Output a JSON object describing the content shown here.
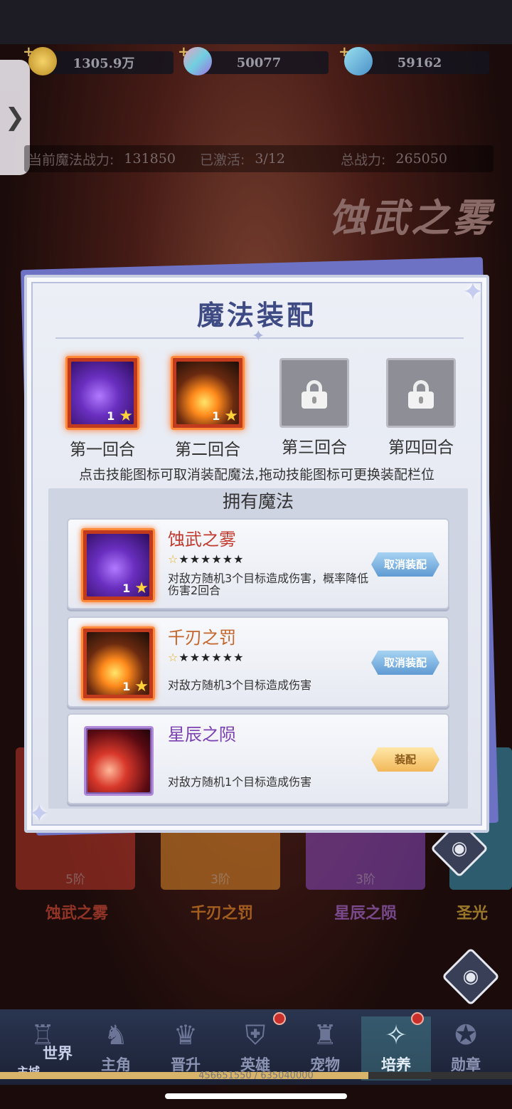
{
  "resources": [
    {
      "value": "1305.9万",
      "icon": "gold-coin-icon",
      "color": "#e0b445"
    },
    {
      "value": "50077",
      "icon": "gem-icon",
      "color": "#7ad0d8"
    },
    {
      "value": "59162",
      "icon": "crystal-icon",
      "color": "#8ac8e8"
    }
  ],
  "power": {
    "magic_power_label": "当前魔法战力:",
    "magic_power_value": "131850",
    "activated_label": "已激活:",
    "activated_value": "3/12",
    "total_label": "总战力:",
    "total_value": "265050"
  },
  "background_title": "蚀武之雾",
  "modal": {
    "title": "魔法装配",
    "slots": [
      {
        "label": "第一回合",
        "state": "equipped",
        "art": "mist",
        "level": "1"
      },
      {
        "label": "第二回合",
        "state": "equipped",
        "art": "blade",
        "level": "1"
      },
      {
        "label": "第三回合",
        "state": "locked"
      },
      {
        "label": "第四回合",
        "state": "locked"
      }
    ],
    "hint": "点击技能图标可取消装配魔法,拖动技能图标可更换装配栏位",
    "owned_title": "拥有魔法",
    "skills": [
      {
        "name": "蚀武之雾",
        "name_color": "#c0392b",
        "stars": "★★★★★★",
        "desc": "对敌方随机3个目标造成伤害，概率降低伤害2回合",
        "button": "取消装配",
        "level": "1"
      },
      {
        "name": "千刃之罚",
        "name_color": "#c4652a",
        "stars": "★★★★★★",
        "desc": "对敌方随机3个目标造成伤害",
        "button": "取消装配",
        "level": "1"
      },
      {
        "name": "星辰之陨",
        "name_color": "#7a3fb0",
        "stars": "",
        "desc": "对敌方随机1个目标造成伤害",
        "button": "装配"
      }
    ]
  },
  "bg_cards": [
    {
      "rank": "5阶",
      "name": "蚀武之雾",
      "color": "#c0392b",
      "name_color": "#e0503a"
    },
    {
      "rank": "3阶",
      "name": "千刃之罚",
      "color": "#e08a2a",
      "name_color": "#f0902a"
    },
    {
      "rank": "3阶",
      "name": "星辰之陨",
      "color": "#8a4ac0",
      "name_color": "#b070e0"
    },
    {
      "rank": "",
      "name": "圣光",
      "color": "#3aa0c0",
      "name_color": "#f0c040"
    }
  ],
  "nav": {
    "world": "世界",
    "main_city": "主城",
    "items": [
      "主角",
      "晋升",
      "英雄",
      "宠物",
      "培养",
      "勋章"
    ],
    "active_index": 4,
    "exp_text": "456651550 / 635040000",
    "exp_fraction": 0.72
  }
}
